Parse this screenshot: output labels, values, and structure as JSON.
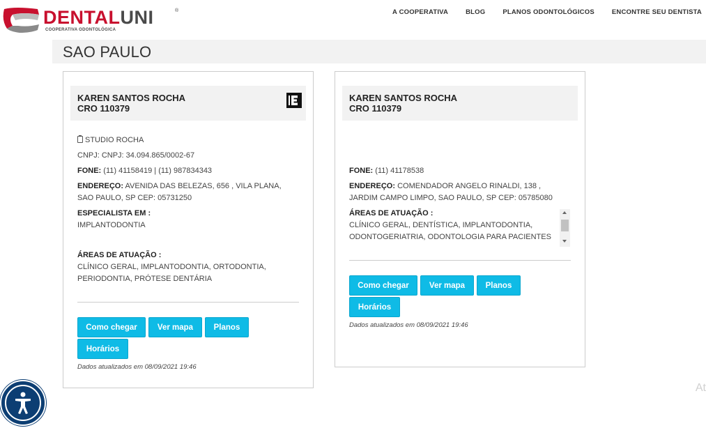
{
  "brand": {
    "name_part1": "DENTAL",
    "name_part2": "UNI",
    "registered": "®",
    "subtitle": "COOPERATIVA ODONTOLÓGICA",
    "color_red": "#c8102e",
    "color_gray": "#4a4a4a"
  },
  "nav": {
    "items": [
      {
        "label": "A COOPERATIVA"
      },
      {
        "label": "BLOG"
      },
      {
        "label": "PLANOS ODONTOLÓGICOS"
      },
      {
        "label": "ENCONTRE SEU DENTISTA"
      }
    ]
  },
  "page_title": "SAO PAULO",
  "cards": [
    {
      "name": "KAREN SANTOS ROCHA",
      "cro": "CRO 110379",
      "badge_icon": "e-badge-icon",
      "clinic_icon": "clipboard-icon",
      "clinic": "STUDIO ROCHA",
      "cnpj": "CNPJ: CNPJ: 34.094.865/0002-67",
      "phone_label": "FONE:",
      "phone": "(11) 41158419 | (11) 987834343",
      "address_label": "ENDEREÇO:",
      "address_line1": "AVENIDA DAS BELEZAS, 656 , VILA PLANA,",
      "address_line2": "SAO PAULO, SP CEP: 05731250",
      "specialist_label": "ESPECIALISTA EM :",
      "specialist": "IMPLANTODONTIA",
      "areas_label": "ÁREAS DE ATUAÇÃO :",
      "areas_line1": "CLÍNICO GERAL, IMPLANTODONTIA, ORTODONTIA,",
      "areas_line2": "PERIODONTIA, PRÓTESE DENTÁRIA",
      "buttons": {
        "directions": "Como chegar",
        "map": "Ver mapa",
        "plans": "Planos",
        "hours": "Horários"
      },
      "updated": "Dados atualizados em 08/09/2021 19:46"
    },
    {
      "name": "KAREN SANTOS ROCHA",
      "cro": "CRO 110379",
      "phone_label": "FONE:",
      "phone": "(11) 41178538",
      "address_label": "ENDEREÇO:",
      "address_line1": "COMENDADOR ANGELO RINALDI, 138 ,",
      "address_line2": "JARDIM CAMPO LIMPO, SAO PAULO, SP CEP: 05785080",
      "areas_label": "ÁREAS DE ATUAÇÃO :",
      "areas_line1": "CLÍNICO GERAL, DENTÍSTICA, IMPLANTODONTIA,",
      "areas_line2": "ODONTOGERIATRIA, ODONTOLOGIA PARA PACIENTES",
      "buttons": {
        "directions": "Como chegar",
        "map": "Ver mapa",
        "plans": "Planos",
        "hours": "Horários"
      },
      "updated": "Dados atualizados em 08/09/2021 19:46"
    }
  ],
  "accessibility_icon": "accessibility-icon",
  "corner_text": "At",
  "accent_color": "#0fbbe6"
}
